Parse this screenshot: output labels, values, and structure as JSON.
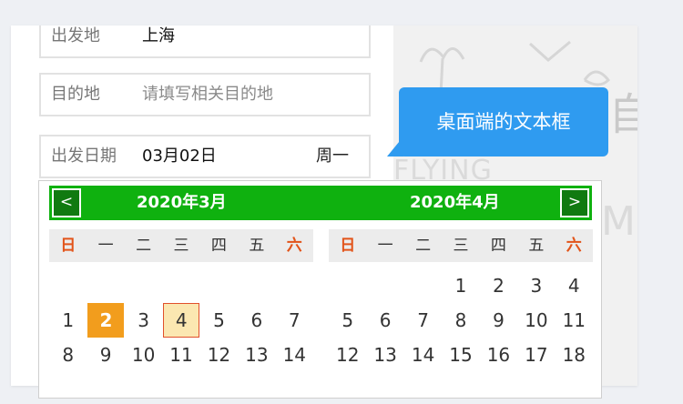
{
  "form": {
    "departure": {
      "label": "出发地",
      "value": "上海"
    },
    "destination": {
      "label": "目的地",
      "placeholder": "请填写相关目的地"
    },
    "date": {
      "label": "出发日期",
      "value": "03月02日",
      "weekday": "周一"
    }
  },
  "tooltip": {
    "text": "桌面端的文本框"
  },
  "background": {
    "texts": [
      "FLYING",
      "M",
      "自"
    ]
  },
  "calendar": {
    "prev_label": "<",
    "next_label": ">",
    "weekdays": [
      "日",
      "一",
      "二",
      "三",
      "四",
      "五",
      "六"
    ],
    "months": [
      {
        "title": "2020年3月",
        "weeks": [
          [
            "",
            "",
            "",
            "",
            "",
            "",
            ""
          ],
          [
            "1",
            "2",
            "3",
            "4",
            "5",
            "6",
            "7"
          ],
          [
            "8",
            "9",
            "10",
            "11",
            "12",
            "13",
            "14"
          ]
        ],
        "selected": "2",
        "highlighted": "4"
      },
      {
        "title": "2020年4月",
        "weeks": [
          [
            "",
            "",
            "",
            "1",
            "2",
            "3",
            "4"
          ],
          [
            "5",
            "6",
            "7",
            "8",
            "9",
            "10",
            "11"
          ],
          [
            "12",
            "13",
            "14",
            "15",
            "16",
            "17",
            "18"
          ]
        ],
        "selected": "",
        "highlighted": ""
      }
    ],
    "colors": {
      "header": "#0fb10f",
      "selected": "#f29d1d",
      "highlight_fill": "#fbe7b1",
      "highlight_border": "#e1502c",
      "weekend": "#e2541a"
    }
  }
}
